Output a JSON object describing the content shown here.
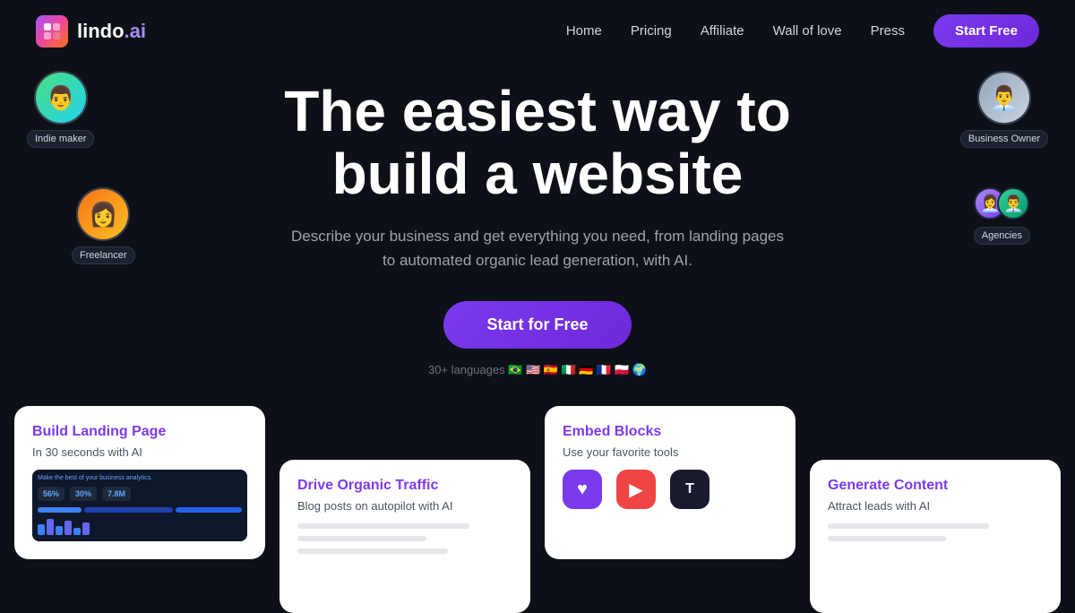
{
  "brand": {
    "name_bold": "lindo",
    "name_suffix": ".ai",
    "logo_alt": "lindo.ai logo"
  },
  "navbar": {
    "links": [
      {
        "label": "Home",
        "id": "home"
      },
      {
        "label": "Pricing",
        "id": "pricing"
      },
      {
        "label": "Affiliate",
        "id": "affiliate"
      },
      {
        "label": "Wall of love",
        "id": "wall-of-love"
      },
      {
        "label": "Press",
        "id": "press"
      }
    ],
    "cta_label": "Start Free"
  },
  "hero": {
    "title_line1": "The easiest way to",
    "title_line2": "build a website",
    "subtitle": "Describe your business and get everything you need, from landing pages to automated organic lead generation, with AI.",
    "cta_label": "Start for Free",
    "languages_text": "30+ languages 🇧🇷 🇺🇸 🇪🇸 🇮🇹 🇩🇪 🇫🇷 🇵🇱 🌍"
  },
  "avatars": [
    {
      "id": "indie-maker",
      "label": "Indie maker",
      "position": "top-left"
    },
    {
      "id": "freelancer",
      "label": "Freelancer",
      "position": "mid-left"
    },
    {
      "id": "business-owner",
      "label": "Business Owner",
      "position": "top-right"
    },
    {
      "id": "agencies",
      "label": "Agencies",
      "position": "mid-right"
    }
  ],
  "cards": [
    {
      "id": "build-landing",
      "title": "Build Landing Page",
      "subtitle": "In 30 seconds with AI",
      "has_preview": true
    },
    {
      "id": "drive-traffic",
      "title": "Drive Organic Traffic",
      "subtitle": "Blog posts on autopilot with AI",
      "has_preview": false
    },
    {
      "id": "embed-blocks",
      "title": "Embed Blocks",
      "subtitle": "Use your favorite tools",
      "has_preview": false
    },
    {
      "id": "generate-content",
      "title": "Generate Content",
      "subtitle": "Attract leads with AI",
      "has_preview": false
    }
  ],
  "colors": {
    "bg": "#0d1117",
    "accent": "#7c3aed",
    "card_title": "#7c3aed"
  }
}
